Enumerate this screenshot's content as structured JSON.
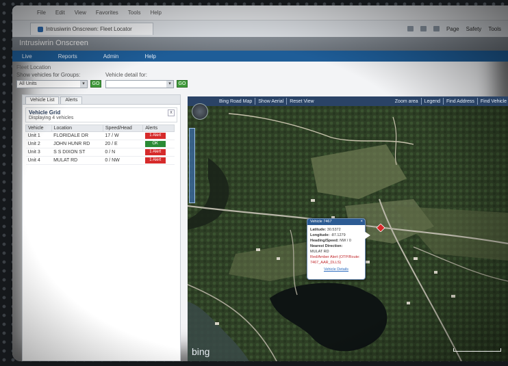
{
  "browser": {
    "menu": [
      "File",
      "Edit",
      "View",
      "Favorites",
      "Tools",
      "Help"
    ],
    "tab_title": "Intrusiwrin Onscrewn: Fleet Locator",
    "tools": [
      "Page",
      "Safety",
      "Tools"
    ]
  },
  "app": {
    "title": "Intrusiwrin Onscreen",
    "nav": [
      "Live",
      "Reports",
      "Admin",
      "Help"
    ]
  },
  "page": {
    "breadcrumb": "Fleet Location",
    "filter_group_label": "Show vehicles for Groups:",
    "filter_group_value": "All Units",
    "filter_vehicle_label": "Vehicle detail for:",
    "filter_vehicle_value": "",
    "go_label": "GO"
  },
  "left_panel": {
    "tabs": [
      "Vehicle List",
      "Alerts"
    ],
    "group_name": "Vehicle Grid",
    "group_count": "Displaying 4 vehicles",
    "close": "x",
    "columns": [
      "Vehicle",
      "Location",
      "Speed/Head",
      "Alerts"
    ],
    "rows": [
      {
        "vehicle": "Unit 1",
        "location": "FLORIDALE DR",
        "speed": "17 / W",
        "alert": "1 Alert",
        "alert_color": "red"
      },
      {
        "vehicle": "Unit 2",
        "location": "JOHN HUNR RD",
        "speed": "20 / E",
        "alert": "OK",
        "alert_color": "green"
      },
      {
        "vehicle": "Unit 3",
        "location": "S S DIXON ST",
        "speed": "0 / N",
        "alert": "1 Alert",
        "alert_color": "red"
      },
      {
        "vehicle": "Unit 4",
        "location": "MULAT RD",
        "speed": "0 / NW",
        "alert": "1 Alert",
        "alert_color": "red"
      }
    ]
  },
  "map": {
    "toolbar_left": [
      "Bing Road Map",
      "Show Aerial",
      "Reset View"
    ],
    "toolbar_right": [
      "Zoom area",
      "Legend",
      "Find Address",
      "Find Vehicle"
    ],
    "attribution": "bing",
    "popup": {
      "title": "Vehicle 7467",
      "latitude_label": "Latitude:",
      "latitude": "30.5372",
      "longitude_label": "Longitude:",
      "longitude": "-87.1279",
      "heading_label": "Heading/Speed:",
      "heading": "NW / 0",
      "nearest_label": "Nearest Direction:",
      "nearest": "MULAT RD",
      "warning": "Red/Amber Alert (OTP/Route: 7467_AAR_DLLS)",
      "link": "Vehicle Details"
    }
  },
  "colors": {
    "nav_blue": "#1e5d98",
    "map_toolbar": "#2a4366",
    "alert_red": "#d62b2b",
    "alert_green": "#2a8a34"
  }
}
